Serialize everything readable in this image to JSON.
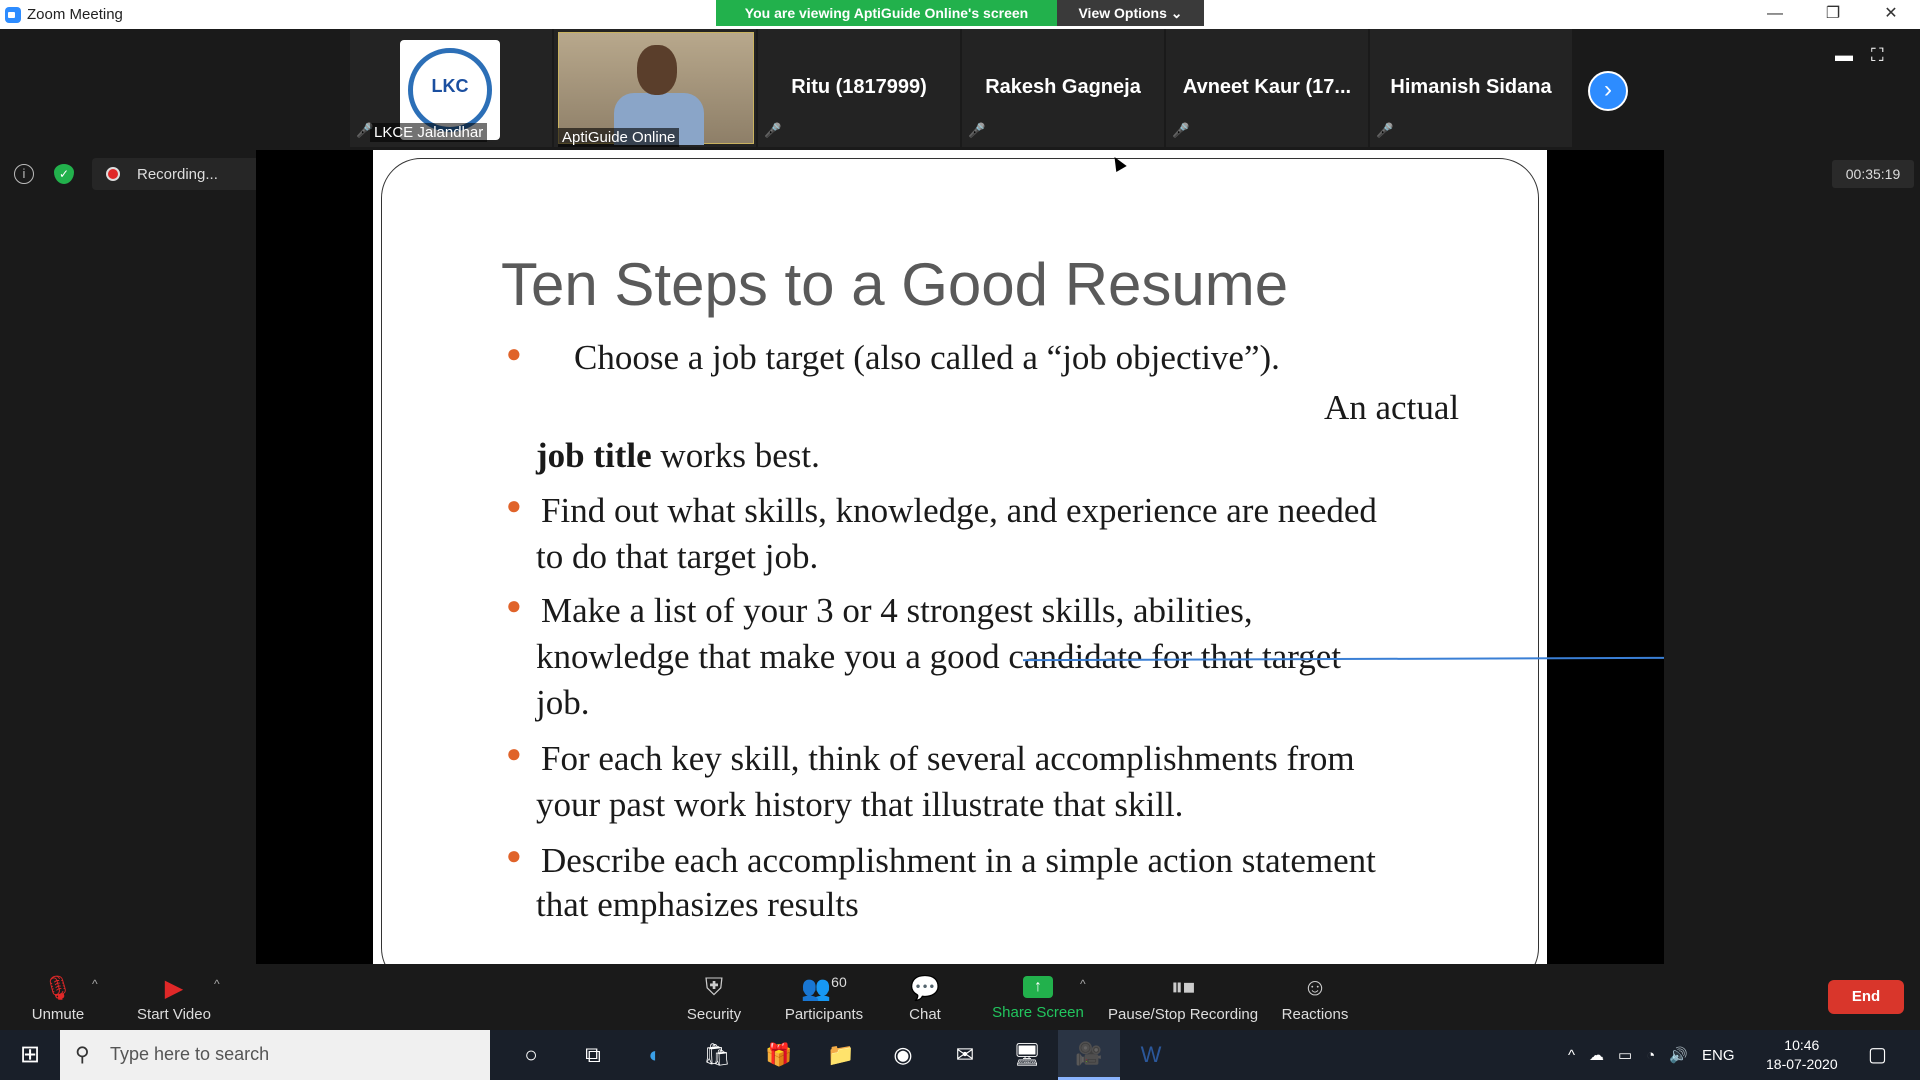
{
  "window": {
    "title": "Zoom Meeting",
    "banner_text": "You are viewing AptiGuide Online's screen",
    "view_options": "View Options ⌄",
    "btn_min": "—",
    "btn_restore": "❐",
    "btn_close": "✕"
  },
  "participants": {
    "logo_text": "LKC",
    "items": [
      {
        "tag": "LKCE Jalandhar"
      },
      {
        "tag": "AptiGuide Online"
      },
      {
        "name": "Ritu (1817999)"
      },
      {
        "name": "Rakesh Gagneja"
      },
      {
        "name": "Avneet Kaur (17..."
      },
      {
        "name": "Himanish Sidana"
      }
    ],
    "next": "›"
  },
  "recording": {
    "label": "Recording...",
    "timer": "00:35:19"
  },
  "slide": {
    "title": "Ten Steps to a Good Resume",
    "b1_line1": "Choose a job target (also called a “job objective”).",
    "b1_line2": "An actual",
    "b1_bold": "job title",
    "b1_rest": " works best.",
    "b2_line1": "Find  out what skills, knowledge, and experience are needed",
    "b2_line2": "to do that target job.",
    "b3_line1": "Make  a list of your 3 or 4 strongest skills, abilities,",
    "b3_line2": "knowledge that make you a good candidate for that target",
    "b3_line3": "job.",
    "b4_line1": "For  each key skill, think of several accomplishments from",
    "b4_line2": "your past work history that illustrate that skill.",
    "b5_line1": "Describe  each accomplishment in a simple action statement",
    "b5_line2": "that emphasizes results"
  },
  "toolbar": {
    "unmute": "Unmute",
    "start_video": "Start Video",
    "security": "Security",
    "participants": "Participants",
    "participants_count": "60",
    "chat": "Chat",
    "share_screen": "Share Screen",
    "pause_stop": "Pause/Stop Recording",
    "reactions": "Reactions",
    "end": "End"
  },
  "taskbar": {
    "search_placeholder": "Type here to search",
    "lang": "ENG",
    "time": "10:46",
    "date": "18-07-2020"
  },
  "colors": {
    "accent": "#2d8cff",
    "banner_green": "#22b14c",
    "end_red": "#d9362b",
    "bullet_orange": "#e0632a"
  }
}
